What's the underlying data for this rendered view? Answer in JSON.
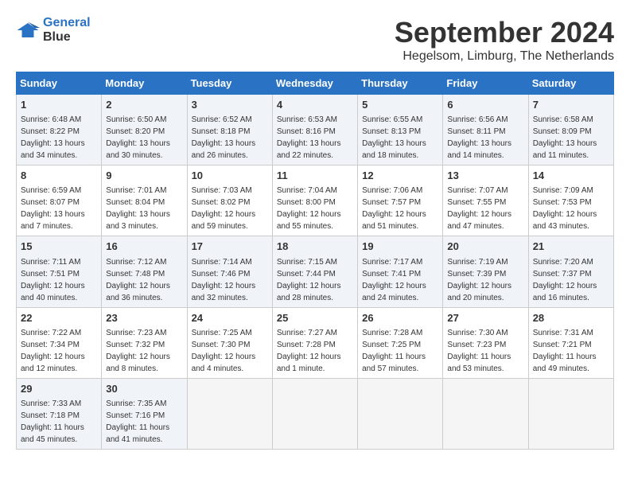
{
  "header": {
    "logo_line1": "General",
    "logo_line2": "Blue",
    "month": "September 2024",
    "location": "Hegelsom, Limburg, The Netherlands"
  },
  "weekdays": [
    "Sunday",
    "Monday",
    "Tuesday",
    "Wednesday",
    "Thursday",
    "Friday",
    "Saturday"
  ],
  "weeks": [
    [
      {
        "day": "1",
        "info": "Sunrise: 6:48 AM\nSunset: 8:22 PM\nDaylight: 13 hours\nand 34 minutes."
      },
      {
        "day": "2",
        "info": "Sunrise: 6:50 AM\nSunset: 8:20 PM\nDaylight: 13 hours\nand 30 minutes."
      },
      {
        "day": "3",
        "info": "Sunrise: 6:52 AM\nSunset: 8:18 PM\nDaylight: 13 hours\nand 26 minutes."
      },
      {
        "day": "4",
        "info": "Sunrise: 6:53 AM\nSunset: 8:16 PM\nDaylight: 13 hours\nand 22 minutes."
      },
      {
        "day": "5",
        "info": "Sunrise: 6:55 AM\nSunset: 8:13 PM\nDaylight: 13 hours\nand 18 minutes."
      },
      {
        "day": "6",
        "info": "Sunrise: 6:56 AM\nSunset: 8:11 PM\nDaylight: 13 hours\nand 14 minutes."
      },
      {
        "day": "7",
        "info": "Sunrise: 6:58 AM\nSunset: 8:09 PM\nDaylight: 13 hours\nand 11 minutes."
      }
    ],
    [
      {
        "day": "8",
        "info": "Sunrise: 6:59 AM\nSunset: 8:07 PM\nDaylight: 13 hours\nand 7 minutes."
      },
      {
        "day": "9",
        "info": "Sunrise: 7:01 AM\nSunset: 8:04 PM\nDaylight: 13 hours\nand 3 minutes."
      },
      {
        "day": "10",
        "info": "Sunrise: 7:03 AM\nSunset: 8:02 PM\nDaylight: 12 hours\nand 59 minutes."
      },
      {
        "day": "11",
        "info": "Sunrise: 7:04 AM\nSunset: 8:00 PM\nDaylight: 12 hours\nand 55 minutes."
      },
      {
        "day": "12",
        "info": "Sunrise: 7:06 AM\nSunset: 7:57 PM\nDaylight: 12 hours\nand 51 minutes."
      },
      {
        "day": "13",
        "info": "Sunrise: 7:07 AM\nSunset: 7:55 PM\nDaylight: 12 hours\nand 47 minutes."
      },
      {
        "day": "14",
        "info": "Sunrise: 7:09 AM\nSunset: 7:53 PM\nDaylight: 12 hours\nand 43 minutes."
      }
    ],
    [
      {
        "day": "15",
        "info": "Sunrise: 7:11 AM\nSunset: 7:51 PM\nDaylight: 12 hours\nand 40 minutes."
      },
      {
        "day": "16",
        "info": "Sunrise: 7:12 AM\nSunset: 7:48 PM\nDaylight: 12 hours\nand 36 minutes."
      },
      {
        "day": "17",
        "info": "Sunrise: 7:14 AM\nSunset: 7:46 PM\nDaylight: 12 hours\nand 32 minutes."
      },
      {
        "day": "18",
        "info": "Sunrise: 7:15 AM\nSunset: 7:44 PM\nDaylight: 12 hours\nand 28 minutes."
      },
      {
        "day": "19",
        "info": "Sunrise: 7:17 AM\nSunset: 7:41 PM\nDaylight: 12 hours\nand 24 minutes."
      },
      {
        "day": "20",
        "info": "Sunrise: 7:19 AM\nSunset: 7:39 PM\nDaylight: 12 hours\nand 20 minutes."
      },
      {
        "day": "21",
        "info": "Sunrise: 7:20 AM\nSunset: 7:37 PM\nDaylight: 12 hours\nand 16 minutes."
      }
    ],
    [
      {
        "day": "22",
        "info": "Sunrise: 7:22 AM\nSunset: 7:34 PM\nDaylight: 12 hours\nand 12 minutes."
      },
      {
        "day": "23",
        "info": "Sunrise: 7:23 AM\nSunset: 7:32 PM\nDaylight: 12 hours\nand 8 minutes."
      },
      {
        "day": "24",
        "info": "Sunrise: 7:25 AM\nSunset: 7:30 PM\nDaylight: 12 hours\nand 4 minutes."
      },
      {
        "day": "25",
        "info": "Sunrise: 7:27 AM\nSunset: 7:28 PM\nDaylight: 12 hours\nand 1 minute."
      },
      {
        "day": "26",
        "info": "Sunrise: 7:28 AM\nSunset: 7:25 PM\nDaylight: 11 hours\nand 57 minutes."
      },
      {
        "day": "27",
        "info": "Sunrise: 7:30 AM\nSunset: 7:23 PM\nDaylight: 11 hours\nand 53 minutes."
      },
      {
        "day": "28",
        "info": "Sunrise: 7:31 AM\nSunset: 7:21 PM\nDaylight: 11 hours\nand 49 minutes."
      }
    ],
    [
      {
        "day": "29",
        "info": "Sunrise: 7:33 AM\nSunset: 7:18 PM\nDaylight: 11 hours\nand 45 minutes."
      },
      {
        "day": "30",
        "info": "Sunrise: 7:35 AM\nSunset: 7:16 PM\nDaylight: 11 hours\nand 41 minutes."
      },
      {
        "day": "",
        "info": ""
      },
      {
        "day": "",
        "info": ""
      },
      {
        "day": "",
        "info": ""
      },
      {
        "day": "",
        "info": ""
      },
      {
        "day": "",
        "info": ""
      }
    ]
  ]
}
